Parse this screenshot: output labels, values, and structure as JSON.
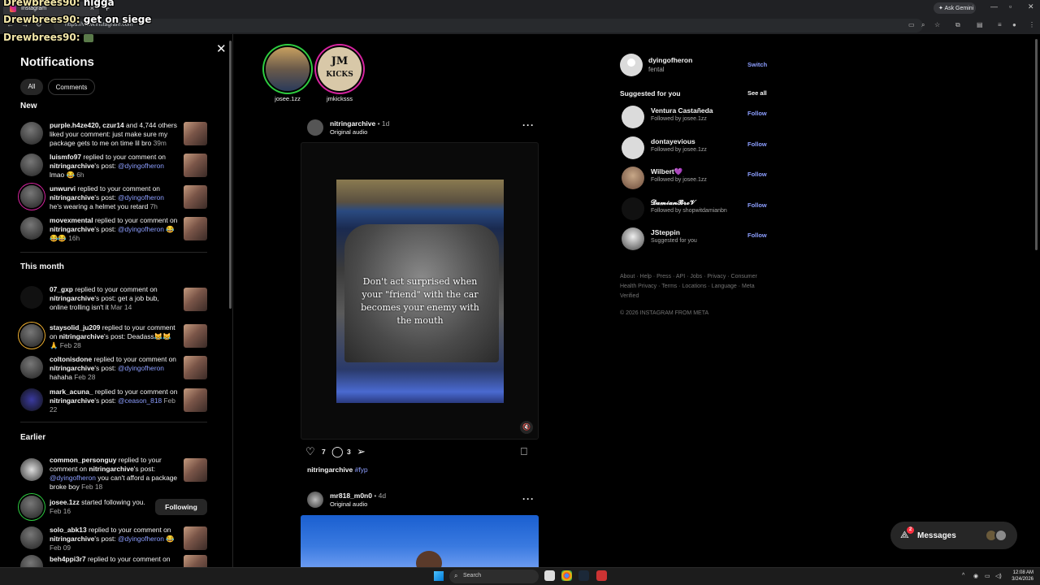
{
  "browser": {
    "tab_title": "Instagram",
    "url": "https://www.instagram.com",
    "gemini_label": "Ask Gemini"
  },
  "overlay": [
    {
      "user": "Drewbrees90:",
      "msg": "nigga"
    },
    {
      "user": "Drewbrees90:",
      "msg": "get on siege"
    },
    {
      "user": "Drewbrees90:",
      "msg": ""
    }
  ],
  "notifications": {
    "title": "Notifications",
    "filters": [
      "All",
      "Comments"
    ],
    "sections": {
      "new": "New",
      "this_month": "This month",
      "earlier": "Earlier"
    },
    "new_items": [
      {
        "user": "purple.h4ze420",
        "extra": ", czur14",
        "text": " and 4,744 others liked your comment: just make sure my package gets to me on time lil bro ",
        "time": "39m"
      },
      {
        "user": "luismfo97",
        "text1": " replied to your comment on ",
        "post": "nitringarchive",
        "text2": "'s post: ",
        "mention": "@dyingofheron",
        "text3": " lmao 😂 ",
        "time": "6h"
      },
      {
        "user": "unwurvi",
        "text1": " replied to your comment on ",
        "post": "nitringarchive",
        "text2": "'s post: ",
        "mention": "@dyingofheron",
        "text3": " he's wearing a helmet you retard ",
        "time": "7h"
      },
      {
        "user": "movexmental",
        "text1": " replied to your comment on ",
        "post": "nitringarchive",
        "text2": "'s post: ",
        "mention": "@dyingofheron",
        "text3": " 😂😂😂 ",
        "time": "16h"
      }
    ],
    "month_items": [
      {
        "user": "07_gxp",
        "text1": " replied to your comment on ",
        "post": "nitringarchive",
        "text2": "'s post: ",
        "mention": "",
        "text3": "get a job bub, online trolling isn't it ",
        "time": "Mar 14"
      },
      {
        "user": "staysolid_ju209",
        "text1": " replied to your comment on ",
        "post": "nitringarchive",
        "text2": "'s post: ",
        "mention": "",
        "text3": "Deadass😹😹🙏 ",
        "time": "Feb 28"
      },
      {
        "user": "coltonisdone",
        "text1": " replied to your comment on ",
        "post": "nitringarchive",
        "text2": "'s post: ",
        "mention": "@dyingofheron",
        "text3": " hahaha ",
        "time": "Feb 28"
      },
      {
        "user": "mark_acuna_",
        "text1": " replied to your comment on ",
        "post": "nitringarchive",
        "text2": "'s post: ",
        "mention": "@ceason_818",
        "text3": " ",
        "time": "Feb 22"
      }
    ],
    "earlier_items": [
      {
        "user": "common_personguy",
        "text1": " replied to your comment on ",
        "post": "nitringarchive",
        "text2": "'s post: ",
        "mention": "@dyingofheron",
        "text3": " you can't afford a package broke boy ",
        "time": "Feb 18"
      },
      {
        "user": "josee.1zz",
        "text1": " started following you. ",
        "post": "",
        "text2": "",
        "mention": "",
        "text3": "",
        "time": "Feb 16"
      },
      {
        "user": "solo_abk13",
        "text1": " replied to your comment on ",
        "post": "nitringarchive",
        "text2": "'s post: ",
        "mention": "@dyingofheron",
        "text3": " 😂 ",
        "time": "Feb 09"
      },
      {
        "user": "beh4ppi3r7",
        "text1": " replied to your comment on",
        "post": "",
        "text2": "",
        "mention": "",
        "text3": "",
        "time": ""
      }
    ],
    "following_label": "Following"
  },
  "stories": [
    {
      "name": "josee.1zz"
    },
    {
      "name": "jmkicksss"
    }
  ],
  "post1": {
    "user": "nitringarchive",
    "age": " • 1d",
    "audio": "Original audio",
    "caption_overlay": "Don't act surprised when your \"friend\" with the car becomes your enemy with the mouth",
    "likes": "7",
    "comments": "3",
    "caption_user": "nitringarchive",
    "hashtag": "#fyp"
  },
  "post2": {
    "user": "mr818_m0n0",
    "age": " • 4d",
    "audio": "Original audio"
  },
  "sidebar": {
    "me_name": "dyingofheron",
    "me_sub": "fental",
    "switch": "Switch",
    "suggested_title": "Suggested for you",
    "see_all": "See all",
    "follow_label": "Follow",
    "suggestions": [
      {
        "name": "Ventura Castañeda",
        "sub": "Followed by josee.1zz"
      },
      {
        "name": "dontayevious",
        "sub": "Followed by josee.1zz"
      },
      {
        "name": "Wilbert💜",
        "sub": "Followed by josee.1zz"
      },
      {
        "name": "𝓓𝓪𝓶𝓲𝓪𝓷𝓑𝓻𝓸𝓥",
        "sub": "Followed by shopwitdamianbn"
      },
      {
        "name": "JSteppin",
        "sub": "Suggested for you"
      }
    ],
    "footer": "About · Help · Press · API · Jobs · Privacy · Consumer Health Privacy · Terms · Locations · Language · Meta Verified",
    "copyright": "© 2026 INSTAGRAM FROM META"
  },
  "messages": {
    "label": "Messages",
    "badge": "2"
  },
  "taskbar": {
    "search": "Search",
    "time": "12:08 AM",
    "date": "3/24/2026"
  }
}
